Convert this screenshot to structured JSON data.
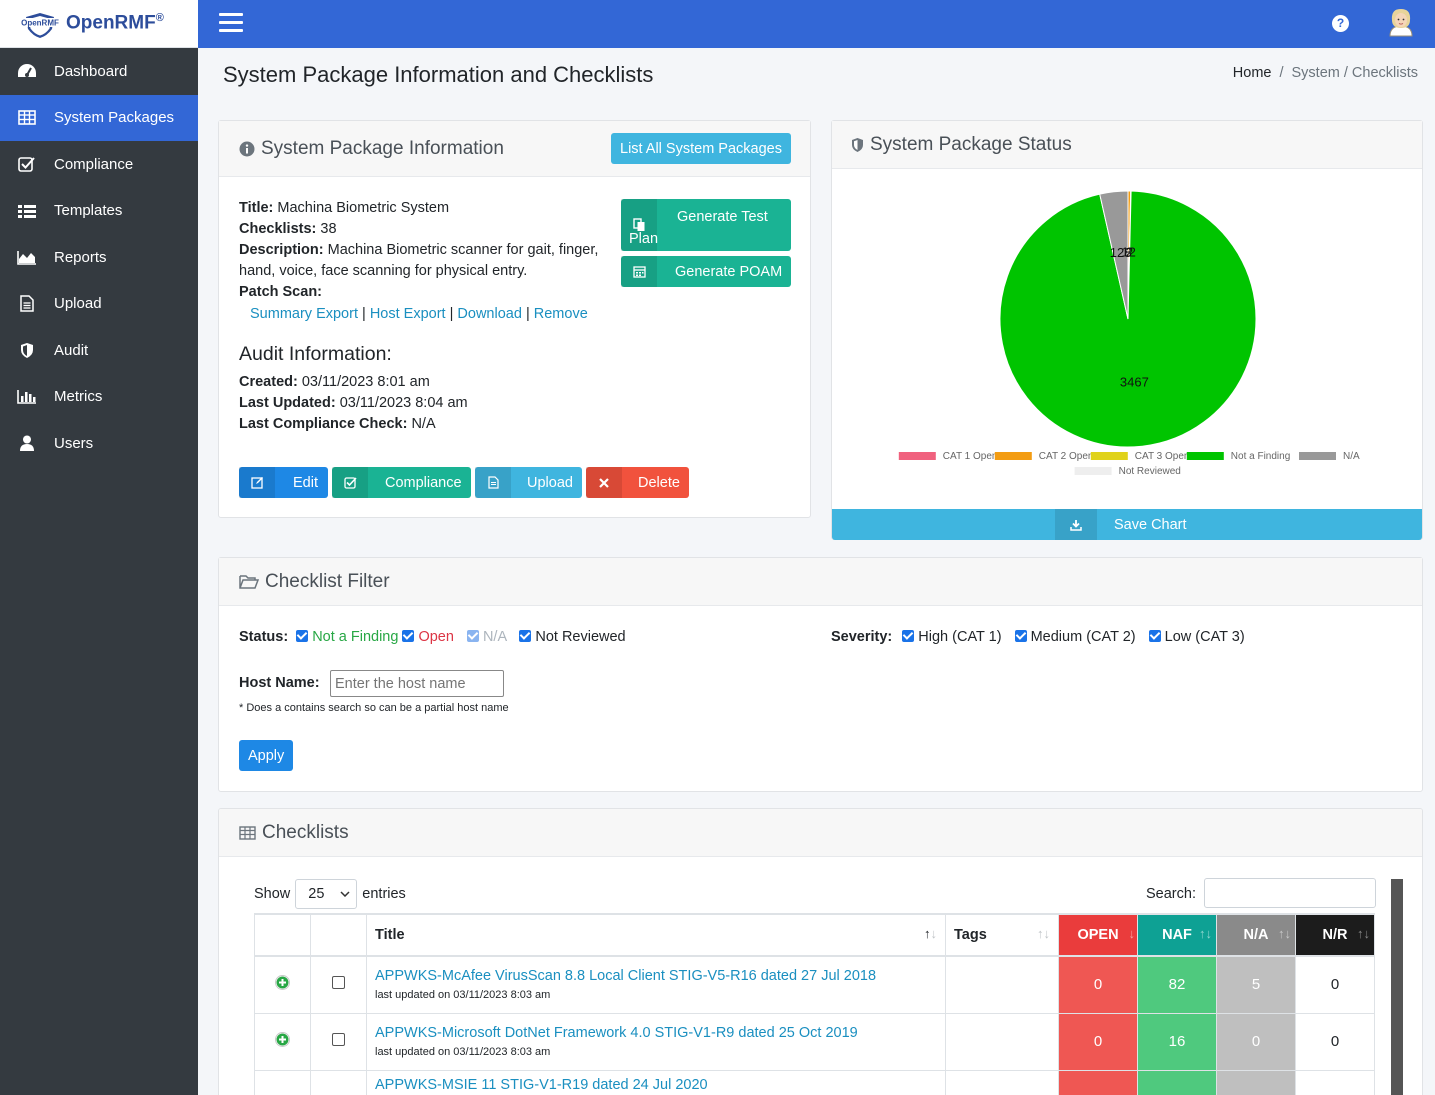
{
  "brand": {
    "logo_text": "OpenRMF",
    "name": "OpenRMF",
    "mark": "®"
  },
  "sidebar": {
    "items": [
      {
        "label": "Dashboard",
        "icon": "dashboard-icon"
      },
      {
        "label": "System Packages",
        "icon": "table-icon",
        "active": true
      },
      {
        "label": "Compliance",
        "icon": "check-square-icon"
      },
      {
        "label": "Templates",
        "icon": "list-icon"
      },
      {
        "label": "Reports",
        "icon": "area-chart-icon"
      },
      {
        "label": "Upload",
        "icon": "file-icon"
      },
      {
        "label": "Audit",
        "icon": "shield-icon"
      },
      {
        "label": "Metrics",
        "icon": "bar-chart-icon"
      },
      {
        "label": "Users",
        "icon": "user-icon"
      }
    ]
  },
  "topbar": {
    "help": "?"
  },
  "header": {
    "title": "System Package Information and Checklists",
    "breadcrumb": {
      "home": "Home",
      "sep": "/",
      "current": "System / Checklists"
    }
  },
  "info": {
    "title": "System Package Information",
    "list_all_button": "List All System Packages",
    "title_label": "Title:",
    "title_value": "Machina Biometric System",
    "checklists_label": "Checklists:",
    "checklists_value": "38",
    "description_label": "Description:",
    "description_value": "Machina Biometric scanner for gait, finger, hand, voice, face scanning for physical entry.",
    "patch_label": "Patch Scan:",
    "patch_links": [
      "Summary Export",
      "Host Export",
      "Download",
      "Remove"
    ],
    "patch_sep": "|",
    "gen_test_plan": "Generate Test Plan",
    "gen_poam": "Generate POAM",
    "audit_heading": "Audit Information:",
    "created_label": "Created:",
    "created_value": "03/11/2023 8:01 am",
    "updated_label": "Last Updated:",
    "updated_value": "03/11/2023 8:04 am",
    "compliance_label": "Last Compliance Check:",
    "compliance_value": "N/A",
    "buttons": {
      "edit": "Edit",
      "compliance": "Compliance",
      "upload": "Upload",
      "delete": "Delete"
    }
  },
  "status": {
    "title": "System Package Status",
    "save_chart": "Save Chart"
  },
  "chart_data": {
    "type": "pie",
    "labels": [
      "CAT 1 Open",
      "CAT 2 Open",
      "CAT 3 Open",
      "Not a Finding",
      "N/A",
      "Not Reviewed"
    ],
    "values": [
      0,
      12,
      2,
      3467,
      128,
      0
    ],
    "value_labels": [
      "128",
      "12",
      "2",
      "3467"
    ],
    "colors": [
      "#f0617e",
      "#f39c12",
      "#e0d21a",
      "#00c400",
      "#999999",
      "#eeeeee"
    ],
    "legend_position": "bottom"
  },
  "filter": {
    "title": "Checklist Filter",
    "status_label": "Status:",
    "status_options": [
      {
        "label": "Not a Finding",
        "color": "#28a745"
      },
      {
        "label": "Open",
        "color": "#dc3545"
      },
      {
        "label": "N/A",
        "color": "#adb5bd"
      },
      {
        "label": "Not Reviewed",
        "color": "#212529"
      }
    ],
    "severity_label": "Severity:",
    "severity_options": [
      "High (CAT 1)",
      "Medium (CAT 2)",
      "Low (CAT 3)"
    ],
    "host_label": "Host Name:",
    "host_placeholder": "Enter the host name",
    "host_note": "* Does a contains search so can be a partial host name",
    "apply": "Apply"
  },
  "checklists": {
    "title": "Checklists",
    "show_label": "Show",
    "show_value": "25",
    "entries_label": "entries",
    "search_label": "Search:",
    "columns": {
      "title": "Title",
      "tags": "Tags",
      "open": "OPEN",
      "naf": "NAF",
      "na": "N/A",
      "nr": "N/R"
    },
    "rows": [
      {
        "title": "APPWKS-McAfee VirusScan 8.8 Local Client STIG-V5-R16 dated 27 Jul 2018",
        "updated": "last updated on 03/11/2023 8:03 am",
        "open": "0",
        "naf": "82",
        "na": "5",
        "nr": "0"
      },
      {
        "title": "APPWKS-Microsoft DotNet Framework 4.0 STIG-V1-R9 dated 25 Oct 2019",
        "updated": "last updated on 03/11/2023 8:03 am",
        "open": "0",
        "naf": "16",
        "na": "0",
        "nr": "0"
      },
      {
        "title": "APPWKS-MSIE 11 STIG-V1-R19 dated 24 Jul 2020",
        "updated": "",
        "open": "",
        "naf": "",
        "na": "",
        "nr": ""
      }
    ]
  }
}
